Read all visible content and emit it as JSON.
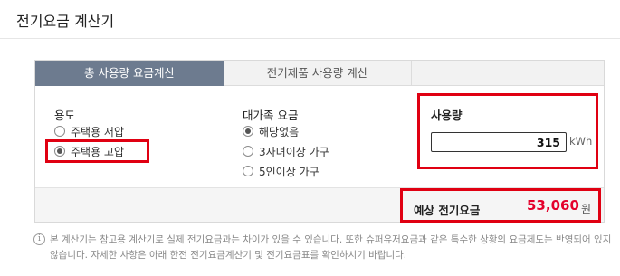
{
  "header": {
    "title": "전기요금 계산기"
  },
  "tabs": [
    {
      "label": "총 사용량 요금계산",
      "active": true
    },
    {
      "label": "전기제품 사용량 계산",
      "active": false
    }
  ],
  "purpose": {
    "title": "용도",
    "options": [
      {
        "label": "주택용 저압",
        "checked": false
      },
      {
        "label": "주택용 고압",
        "checked": true
      }
    ]
  },
  "large_family": {
    "title": "대가족 요금",
    "options": [
      {
        "label": "해당없음",
        "checked": true
      },
      {
        "label": "3자녀이상 가구",
        "checked": false
      },
      {
        "label": "5인이상 가구",
        "checked": false
      }
    ]
  },
  "usage": {
    "title": "사용량",
    "value": "315",
    "unit": "kWh"
  },
  "result": {
    "label": "예상 전기요금",
    "value": "53,060",
    "unit": "원"
  },
  "note": {
    "icon": "info-icon",
    "text": "본 계산기는 참고용 계산기로 실제 전기요금과는 차이가 있을 수 있습니다. 또한 슈퍼유저요금과 같은 특수한 상황의 요금제도는 반영되어 있지 않습니다. 자세한 사항은 아래 한전 전기요금계산기 및 전기요금표를 확인하시기 바랍니다."
  },
  "colors": {
    "active_tab": "#6d7b8f",
    "highlight": "#e00012",
    "result_value": "#e4002b"
  }
}
